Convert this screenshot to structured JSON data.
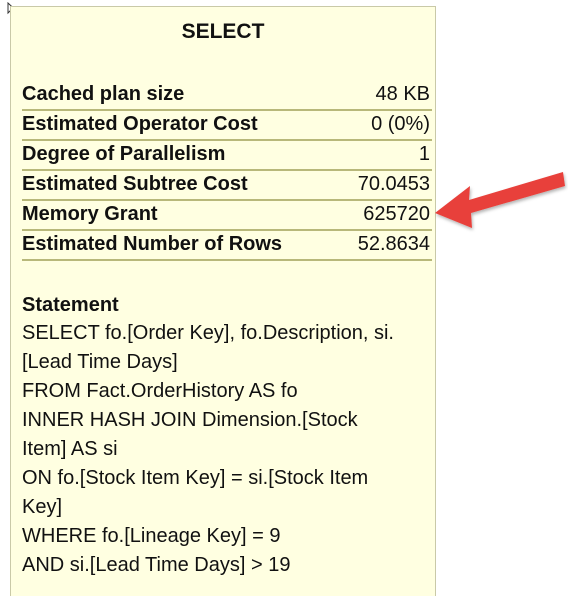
{
  "tooltip": {
    "title": "SELECT",
    "properties": [
      {
        "name": "Cached plan size",
        "value": "48 KB"
      },
      {
        "name": "Estimated Operator Cost",
        "value": "0 (0%)"
      },
      {
        "name": "Degree of Parallelism",
        "value": "1"
      },
      {
        "name": "Estimated Subtree Cost",
        "value": "70.0453"
      },
      {
        "name": "Memory Grant",
        "value": "625720"
      },
      {
        "name": "Estimated Number of Rows",
        "value": "52.8634"
      }
    ],
    "statement_heading": "Statement",
    "statement_lines": [
      "SELECT fo.[Order Key], fo.Description, si.",
      "[Lead Time Days]",
      "FROM  Fact.OrderHistory AS fo",
      "INNER HASH JOIN Dimension.[Stock",
      "Item] AS si",
      "ON fo.[Stock Item Key] = si.[Stock Item",
      "Key]",
      "WHERE fo.[Lineage Key] = 9",
      "AND si.[Lead Time Days] > 19"
    ]
  },
  "colors": {
    "tooltip_background": "#ffffe1",
    "row_divider": "#b8b87a",
    "arrow": "#e8403a"
  },
  "icons": {
    "cursor": "pointer-cursor-icon",
    "arrow": "callout-arrow"
  }
}
